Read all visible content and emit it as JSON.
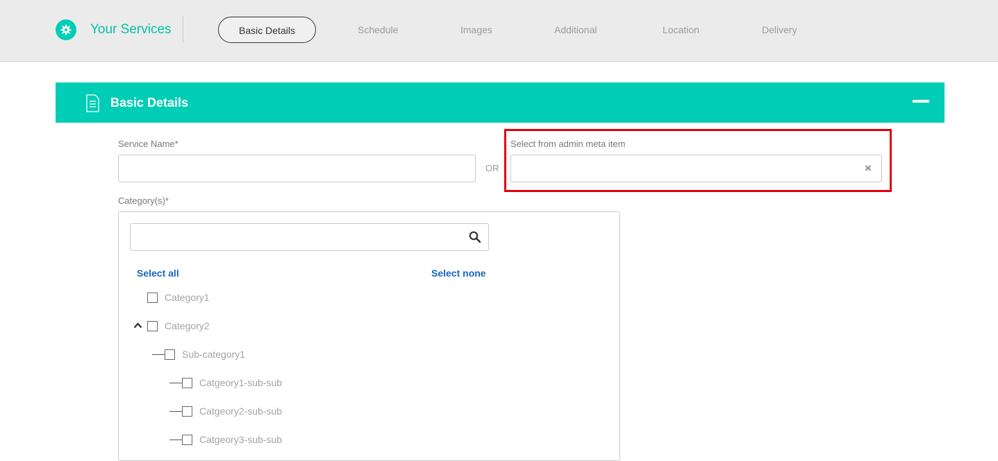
{
  "header": {
    "brand_icon": "gear-icon",
    "title": "Your Services",
    "steps": [
      {
        "label": "Basic Details",
        "active": true
      },
      {
        "label": "Schedule",
        "active": false
      },
      {
        "label": "Images",
        "active": false
      },
      {
        "label": "Additional",
        "active": false
      },
      {
        "label": "Location",
        "active": false
      },
      {
        "label": "Delivery",
        "active": false
      }
    ]
  },
  "panel": {
    "icon": "document-icon",
    "title": "Basic Details",
    "collapse_icon": "minus-icon"
  },
  "form": {
    "service_name_label": "Service Name*",
    "service_name_value": "",
    "or_text": "OR",
    "admin_meta_label": "Select from admin meta item",
    "admin_meta_value": "",
    "clear_icon": "×",
    "category_label": "Category(s)*",
    "category_search_value": "",
    "select_all": "Select all",
    "select_none": "Select none",
    "tree": [
      {
        "label": "Category1",
        "level": 0,
        "checked": false,
        "expandable": false
      },
      {
        "label": "Category2",
        "level": 0,
        "checked": false,
        "expandable": true,
        "expanded": true
      },
      {
        "label": "Sub-category1",
        "level": 1,
        "checked": false
      },
      {
        "label": "Catgeory1-sub-sub",
        "level": 2,
        "checked": false
      },
      {
        "label": "Catgeory2-sub-sub",
        "level": 2,
        "checked": false
      },
      {
        "label": "Catgeory3-sub-sub",
        "level": 2,
        "checked": false
      }
    ]
  },
  "colors": {
    "accent": "#00cdb5",
    "link": "#1565c0",
    "highlight": "#e3000b"
  }
}
